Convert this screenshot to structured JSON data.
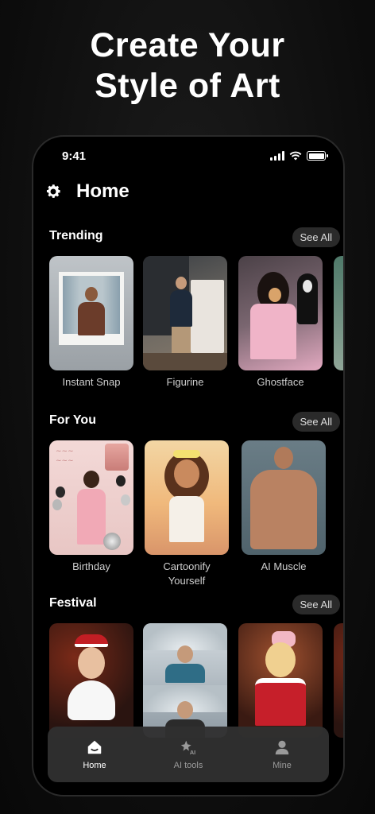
{
  "headline": {
    "line1": "Create Your",
    "line2": "Style of Art"
  },
  "status_bar": {
    "time": "9:41"
  },
  "header": {
    "title": "Home",
    "settings_icon": "gear-icon"
  },
  "sections": [
    {
      "title": "Trending",
      "see_all": "See All",
      "items": [
        {
          "label": "Instant Snap"
        },
        {
          "label": "Figurine"
        },
        {
          "label": "Ghostface"
        }
      ]
    },
    {
      "title": "For You",
      "see_all": "See All",
      "items": [
        {
          "label": "Birthday"
        },
        {
          "label": "Cartoonify Yourself"
        },
        {
          "label": "AI Muscle"
        }
      ]
    },
    {
      "title": "Festival",
      "see_all": "See All",
      "items": [
        {
          "label": ""
        },
        {
          "label": ""
        },
        {
          "label": ""
        }
      ]
    }
  ],
  "nav": [
    {
      "label": "Home",
      "icon": "home-icon",
      "active": true
    },
    {
      "label": "AI tools",
      "icon": "ai-tools-icon",
      "active": false
    },
    {
      "label": "Mine",
      "icon": "profile-icon",
      "active": false
    }
  ],
  "colors": {
    "background": "#000000",
    "pill": "#2a2a2a",
    "navbar": "#303030",
    "text": "#ffffff"
  }
}
